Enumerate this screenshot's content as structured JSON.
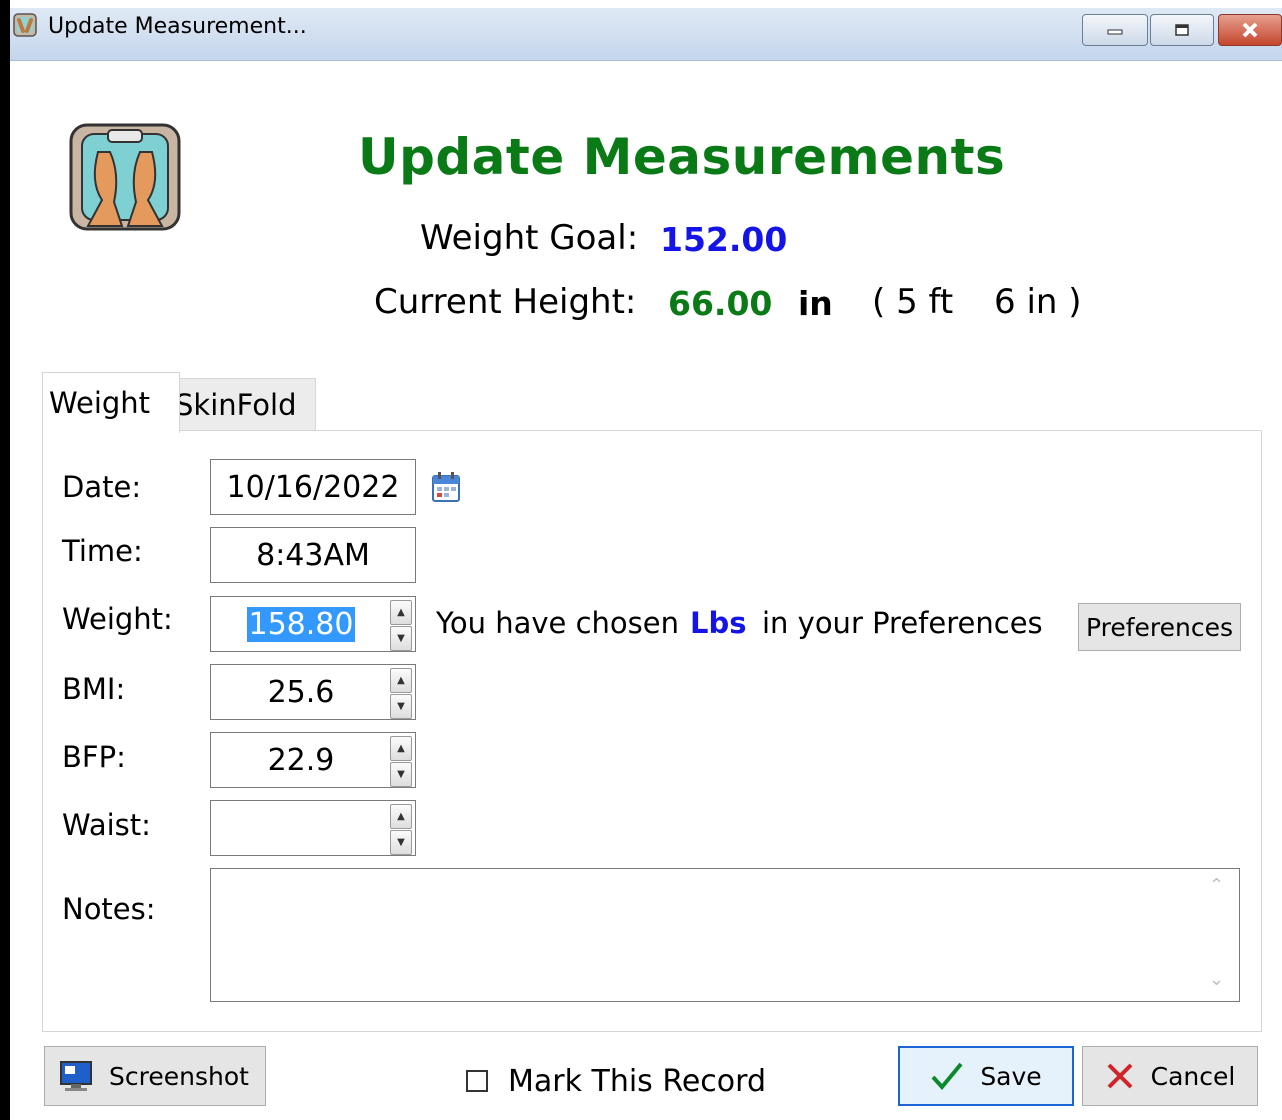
{
  "window": {
    "title": "Update Measurement...",
    "icon": "scale-feet-icon",
    "controls": [
      "minimize-icon",
      "restore-icon",
      "close-icon"
    ]
  },
  "header": {
    "title": "Update Measurements",
    "weight_goal_label": "Weight Goal:",
    "weight_goal_value": "152.00",
    "height_label": "Current Height:",
    "height_value": "66.00",
    "height_unit": "in",
    "height_feet": "( 5 ft",
    "height_inches": "6 in )"
  },
  "tabs": [
    {
      "label": "Weight",
      "active": true
    },
    {
      "label": "SkinFold",
      "active": false
    }
  ],
  "form": {
    "date_label": "Date:",
    "date_value": "10/16/2022",
    "time_label": "Time:",
    "time_value": "8:43AM",
    "weight_label": "Weight:",
    "weight_value": "158.80",
    "pref_text_1": "You have chosen",
    "pref_unit": "Lbs",
    "pref_text_2": "in your Preferences",
    "preferences_button": "Preferences",
    "bmi_label": "BMI:",
    "bmi_value": "25.6",
    "bfp_label": "BFP:",
    "bfp_value": "22.9",
    "waist_label": "Waist:",
    "waist_value": "",
    "notes_label": "Notes:",
    "notes_value": ""
  },
  "footer": {
    "screenshot_button": "Screenshot",
    "mark_record_label": "Mark This Record",
    "mark_record_checked": false,
    "save_button": "Save",
    "cancel_button": "Cancel"
  },
  "colors": {
    "title_green": "#0a7a17",
    "value_blue": "#1414e6",
    "selection": "#3399ff"
  }
}
